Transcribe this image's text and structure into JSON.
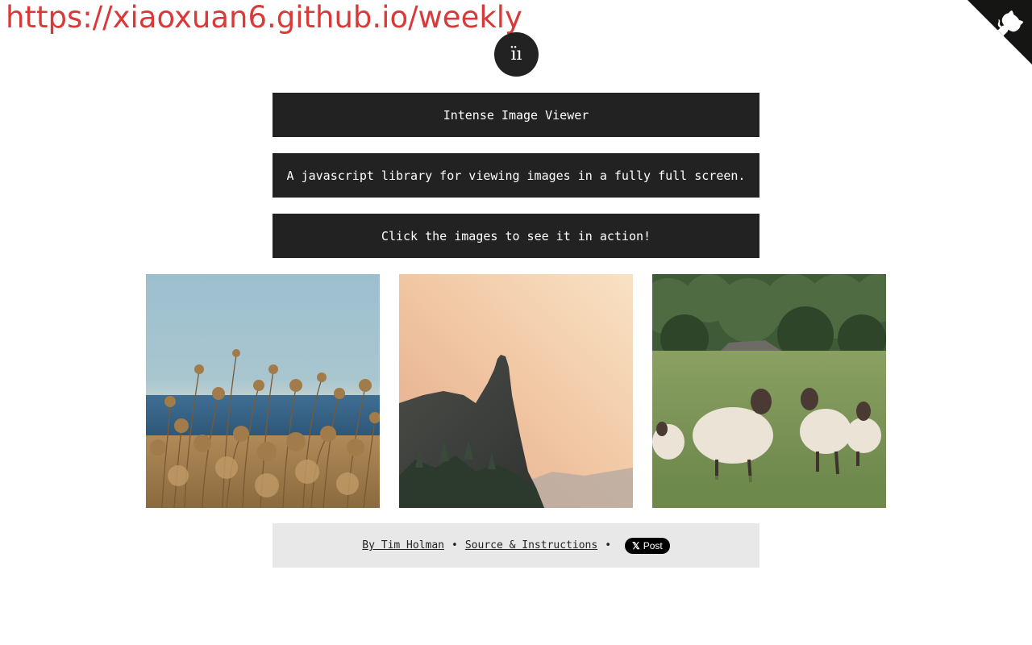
{
  "banner": {
    "url_text": "https://xiaoxuan6.github.io/weekly"
  },
  "corner": {
    "icon": "github-octocat-icon",
    "color": "#151513"
  },
  "logo": {
    "glyph": "ïı",
    "icon": "intense-logo-icon"
  },
  "header": {
    "title": "Intense Image Viewer",
    "description": "A javascript library for viewing images in a fully full screen.",
    "cta": "Click the images to see it in action!"
  },
  "gallery": {
    "images": [
      {
        "subject": "dried-flowers-by-sea"
      },
      {
        "subject": "rock-cliff-sunset"
      },
      {
        "subject": "sheep-in-meadow"
      }
    ]
  },
  "footer": {
    "author_link": "By Tim Holman",
    "separator": "•",
    "source_link": "Source & Instructions",
    "tweet_x": "𝕏",
    "tweet_label": "Post"
  },
  "colors": {
    "banner_text": "#d83a3a",
    "bar_bg": "#222222",
    "footer_bg": "#e8e8e8"
  }
}
